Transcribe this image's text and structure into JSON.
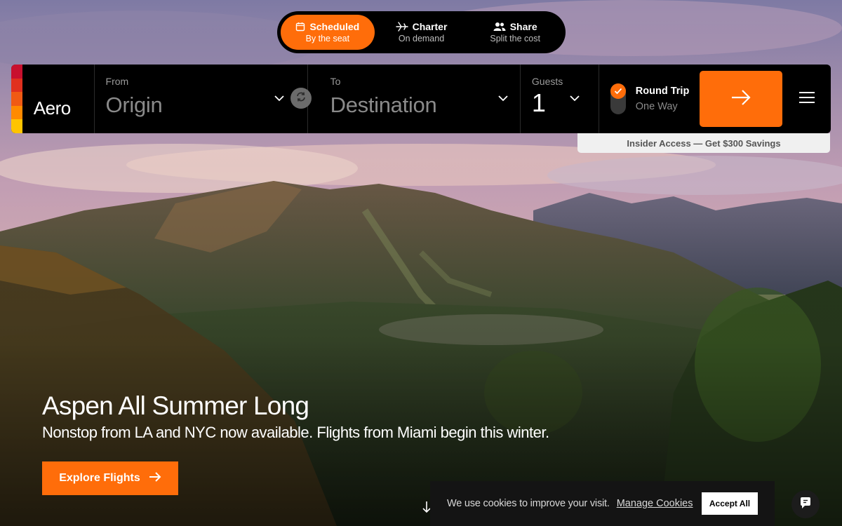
{
  "modes": [
    {
      "label": "Scheduled",
      "sub": "By the seat",
      "icon": "calendar-icon",
      "active": true
    },
    {
      "label": "Charter",
      "sub": "On demand",
      "icon": "plane-icon",
      "active": false
    },
    {
      "label": "Share",
      "sub": "Split the cost",
      "icon": "people-icon",
      "active": false
    }
  ],
  "brand": {
    "name": "Aero",
    "stripe_colors": [
      "#c8102e",
      "#e0301e",
      "#f05a14",
      "#ff8a00",
      "#ffc400"
    ]
  },
  "search": {
    "from_label": "From",
    "from_placeholder": "Origin",
    "to_label": "To",
    "to_placeholder": "Destination",
    "guests_label": "Guests",
    "guests_value": "1",
    "trip_options": [
      "Round Trip",
      "One Way"
    ],
    "trip_selected": "Round Trip"
  },
  "insider": {
    "text": "Insider Access — Get $300 Savings"
  },
  "hero": {
    "title": "Aspen All Summer Long",
    "subtitle": "Nonstop from LA and NYC now available. Flights from Miami begin this winter.",
    "cta_label": "Explore Flights"
  },
  "cookie": {
    "text": "We use cookies to improve your visit.",
    "link": "Manage Cookies",
    "accept": "Accept All"
  },
  "colors": {
    "accent": "#ff6d0a",
    "bar": "#000000"
  }
}
